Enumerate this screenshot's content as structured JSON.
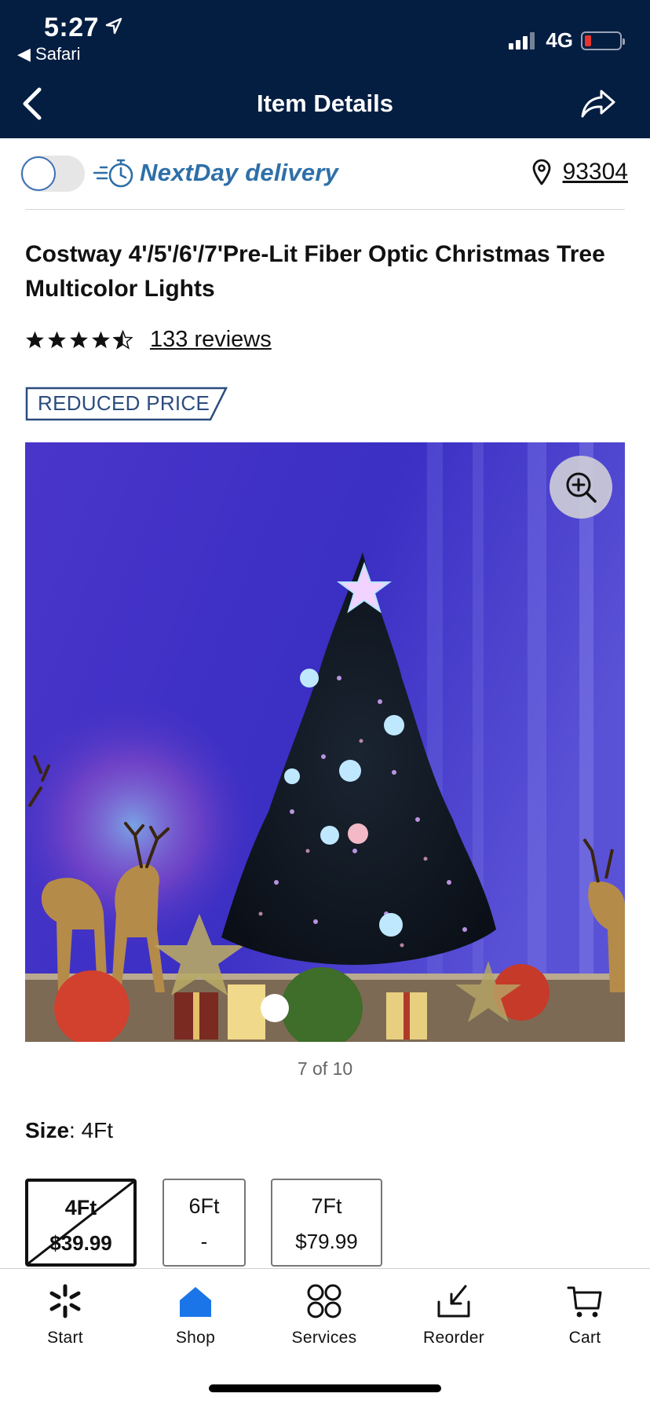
{
  "status_bar": {
    "time": "5:27",
    "back_app": "◀ Safari",
    "network": "4G",
    "battery_level": 0.1
  },
  "header": {
    "title": "Item Details"
  },
  "delivery": {
    "label": "NextDay delivery",
    "toggle_on": false,
    "zip": "93304"
  },
  "product": {
    "title": "Costway 4'/5'/6'/7'Pre-Lit Fiber Optic Christmas Tree Multicolor Lights",
    "rating": 4.5,
    "reviews": "133 reviews",
    "badge": "REDUCED PRICE",
    "image_counter": "7 of 10"
  },
  "size": {
    "label": "Size",
    "selected_value": "4Ft",
    "options": [
      {
        "name": "4Ft",
        "price": "$39.99",
        "selected": true,
        "unavailable": true
      },
      {
        "name": "6Ft",
        "price": "-",
        "selected": false,
        "unavailable": false
      },
      {
        "name": "7Ft",
        "price": "$79.99",
        "selected": false,
        "unavailable": false
      }
    ]
  },
  "tabbar": {
    "items": [
      {
        "label": "Start",
        "icon": "spark-icon",
        "active": false
      },
      {
        "label": "Shop",
        "icon": "home-icon",
        "active": true
      },
      {
        "label": "Services",
        "icon": "grid-icon",
        "active": false
      },
      {
        "label": "Reorder",
        "icon": "reorder-icon",
        "active": false
      },
      {
        "label": "Cart",
        "icon": "cart-icon",
        "active": false
      }
    ]
  },
  "colors": {
    "header_bg": "#041e42",
    "brand_blue": "#2e6fa8",
    "active_tab": "#1a75e8"
  }
}
